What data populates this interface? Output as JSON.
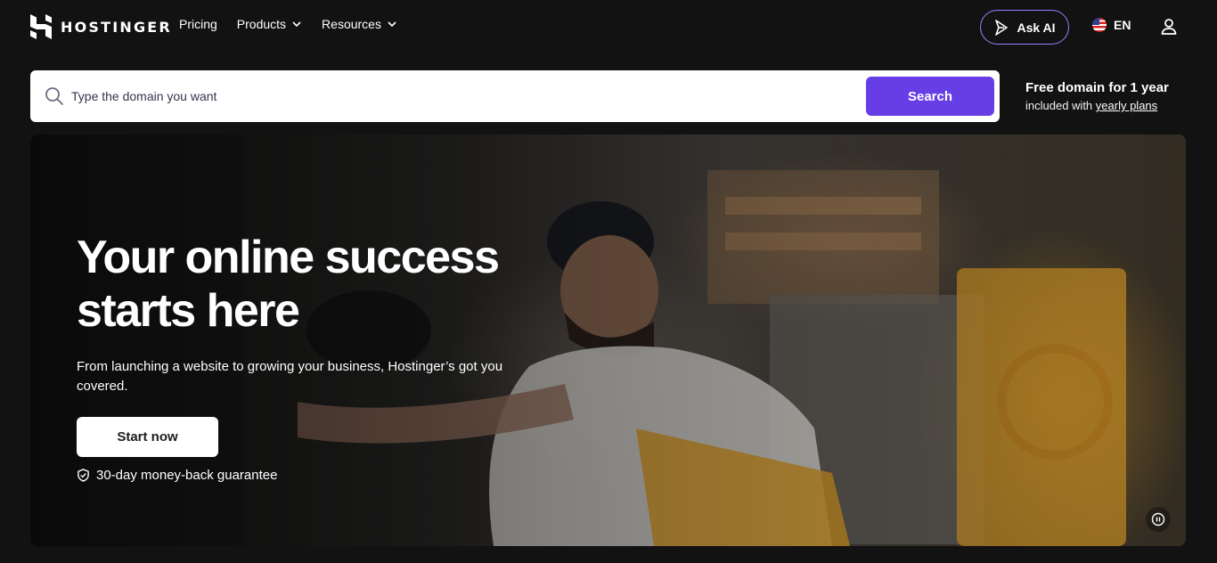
{
  "header": {
    "brand": "HOSTINGER",
    "nav": [
      {
        "label": "Pricing",
        "has_dropdown": false
      },
      {
        "label": "Products",
        "has_dropdown": true
      },
      {
        "label": "Resources",
        "has_dropdown": true
      }
    ],
    "ask_ai_label": "Ask AI",
    "language": "EN",
    "icons": {
      "logo": "hostinger-logo-icon",
      "ask_ai": "sparkle-icon",
      "language": "us-flag-icon",
      "account": "user-icon"
    }
  },
  "domain_search": {
    "placeholder": "Type the domain you want",
    "value": "",
    "button_label": "Search",
    "accent_color": "#673de6"
  },
  "promo": {
    "title": "Free domain for 1 year",
    "subtitle_prefix": "included with ",
    "link_text": "yearly plans"
  },
  "hero": {
    "title_line1": "Your online success",
    "title_line2": "starts here",
    "subtitle": "From launching a website to growing your business, Hostinger’s got you covered.",
    "cta_label": "Start now",
    "guarantee_text": "30-day money-back guarantee",
    "icons": {
      "guarantee": "shield-check-icon",
      "video_control": "pause-icon"
    }
  },
  "colors": {
    "page_background": "#121212",
    "brand_purple": "#673de6",
    "ask_ai_border": "#8c85ff"
  }
}
